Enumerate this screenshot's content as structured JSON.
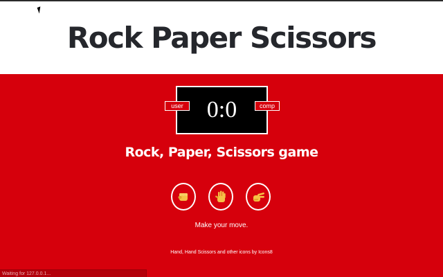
{
  "header": {
    "title": "Rock Paper Scissors"
  },
  "scoreboard": {
    "score": "0:0",
    "user_label": "user",
    "comp_label": "comp"
  },
  "game": {
    "subtitle": "Rock, Paper, Scissors game",
    "choices": [
      {
        "name": "rock",
        "icon": "fist-icon"
      },
      {
        "name": "paper",
        "icon": "open-hand-icon"
      },
      {
        "name": "scissors",
        "icon": "scissors-hand-icon"
      }
    ],
    "prompt": "Make your move."
  },
  "footer": {
    "credits": "Hand, Hand Scissors and other icons by Icons8"
  },
  "status_bar": {
    "text": "Waiting for 127.0.0.1..."
  },
  "colors": {
    "accent": "#d6000c",
    "title": "#25272c",
    "skin": "#f5c046"
  }
}
